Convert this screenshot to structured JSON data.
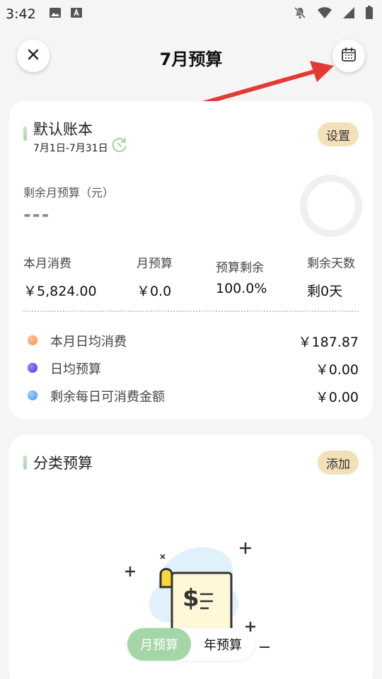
{
  "status_bar": {
    "time": "3:42",
    "icons_left": [
      "image-icon",
      "text-a-icon"
    ],
    "icons_right": [
      "bell-off-icon",
      "wifi-icon",
      "signal-icon",
      "battery-icon"
    ]
  },
  "header": {
    "title": "7月预算",
    "close_icon": "close-icon",
    "calendar_icon": "calendar-icon"
  },
  "budget_card": {
    "title": "默认账本",
    "date_range": "7月1日-7月31日",
    "settings_label": "设置",
    "remaining_label": "剩余月预算（元）",
    "remaining_value": "---",
    "stats": [
      {
        "label": "本月消费",
        "value": "￥5,824.00"
      },
      {
        "label": "月预算",
        "value": "￥0.0"
      },
      {
        "label": "预算剩余",
        "value": "100.0%"
      },
      {
        "label": "剩余天数",
        "value": "剩0天"
      }
    ],
    "daily": [
      {
        "label": "本月日均消费",
        "value": "￥187.87",
        "color": "#ffa05a"
      },
      {
        "label": "日均预算",
        "value": "￥0.00",
        "color": "#5b3ff0"
      },
      {
        "label": "剩余每日可消费金额",
        "value": "￥0.00",
        "color": "#4fa3f7"
      }
    ]
  },
  "category_card": {
    "title": "分类预算",
    "add_label": "添加"
  },
  "bottom_toggle": {
    "month_label": "月预算",
    "year_label": "年预算",
    "active": "month"
  },
  "colors": {
    "accent_green": "#a5d6a7",
    "pill_bg": "#f3e0b9",
    "annotation_red": "#e53935"
  }
}
